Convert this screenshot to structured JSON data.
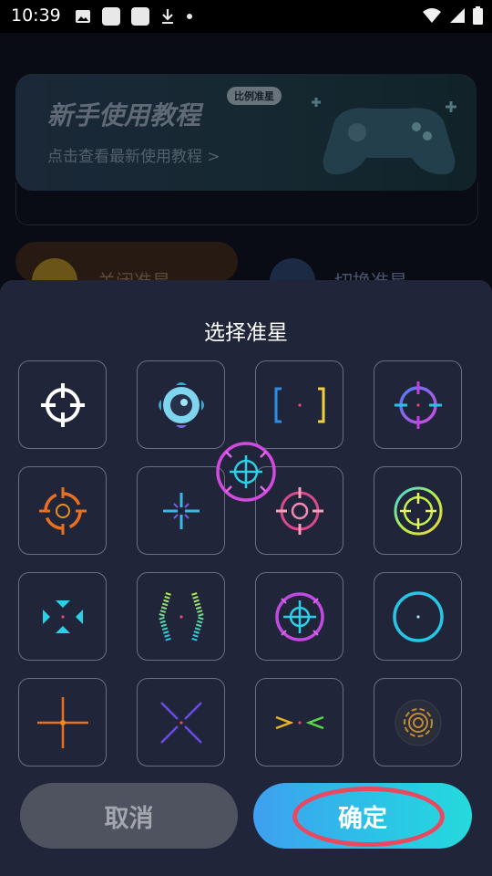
{
  "status_bar": {
    "time": "10:39"
  },
  "background": {
    "tutorial_title": "新手使用教程",
    "tutorial_subtitle": "点击查看最新使用教程 >",
    "tutorial_badge": "比例准星",
    "left_pill_label": "关闭准星",
    "right_pill_label": "切换准星"
  },
  "sheet": {
    "title": "选择准星",
    "options": [
      {
        "icon": "white-crosshair-icon"
      },
      {
        "icon": "blue-eye-crosshair-icon"
      },
      {
        "icon": "bracket-crosshair-icon"
      },
      {
        "icon": "gradient-circle-crosshair-icon"
      },
      {
        "icon": "orange-circle-crosshair-icon"
      },
      {
        "icon": "cyan-plus-crosshair-icon"
      },
      {
        "icon": "pink-ring-crosshair-icon"
      },
      {
        "icon": "rainbow-ring-crosshair-icon"
      },
      {
        "icon": "cyan-arrows-crosshair-icon"
      },
      {
        "icon": "rainbow-brackets-crosshair-icon"
      },
      {
        "icon": "purple-cyan-ring-crosshair-icon"
      },
      {
        "icon": "cyan-circle-crosshair-icon"
      },
      {
        "icon": "orange-cross-crosshair-icon"
      },
      {
        "icon": "blue-x-crosshair-icon"
      },
      {
        "icon": "chevron-crosshair-icon"
      },
      {
        "icon": "target-rings-crosshair-icon"
      }
    ],
    "cancel_label": "取消",
    "confirm_label": "确定"
  }
}
